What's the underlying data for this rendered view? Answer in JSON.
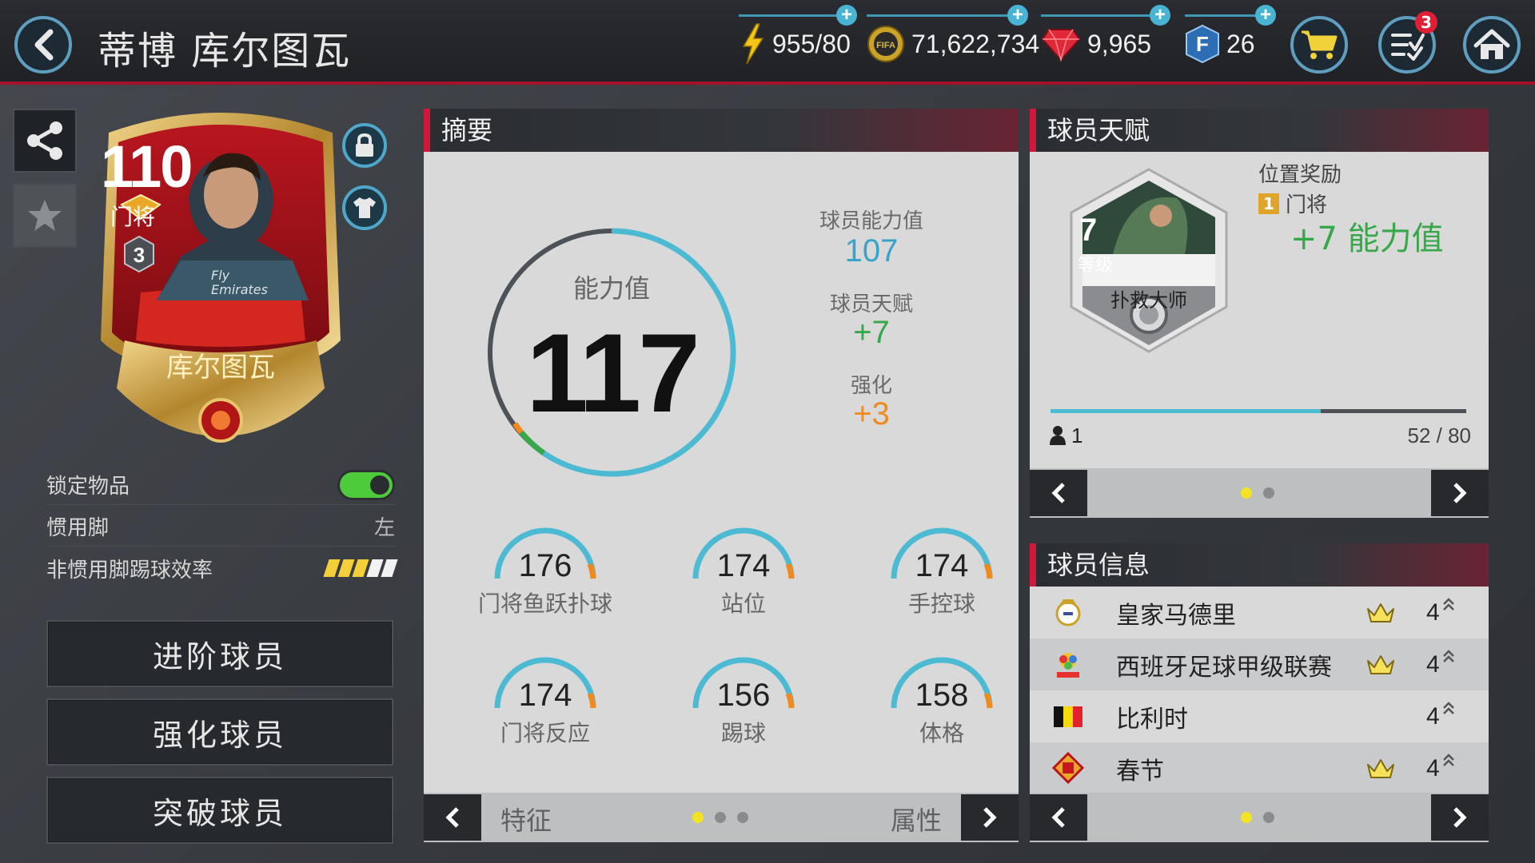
{
  "header": {
    "title": "蒂博 库尔图瓦",
    "energy": "955/80",
    "coins": "71,622,734",
    "gems": "9,965",
    "fifa_points": "26",
    "tasks_badge": "3",
    "coin_icon_text": "FIFA MOBILE",
    "fp_icon_text": "F"
  },
  "card": {
    "rating": "110",
    "position": "门将",
    "rank": "3",
    "name": "库尔图瓦",
    "jersey_text": "Fly Emirates"
  },
  "properties": {
    "lock_label": "锁定物品",
    "lock_on": true,
    "foot_label": "惯用脚",
    "foot_value": "左",
    "weak_foot_label": "非惯用脚踢球效率",
    "weak_foot_stars": 3,
    "weak_foot_max": 5
  },
  "actions": {
    "advance": "进阶球员",
    "enhance": "强化球员",
    "breakthrough": "突破球员"
  },
  "summary": {
    "header": "摘要",
    "ovr_label": "能力值",
    "ovr_value": "117",
    "player_ovr_label": "球员能力值",
    "player_ovr_value": "107",
    "talent_label": "球员天赋",
    "talent_value": "+7",
    "enhance_label": "强化",
    "enhance_value": "+3",
    "stats": [
      {
        "label": "门将鱼跃扑球",
        "value": "176"
      },
      {
        "label": "站位",
        "value": "174"
      },
      {
        "label": "手控球",
        "value": "174"
      },
      {
        "label": "门将反应",
        "value": "174"
      },
      {
        "label": "踢球",
        "value": "156"
      },
      {
        "label": "体格",
        "value": "158"
      }
    ],
    "foot_left": "特征",
    "foot_right": "属性"
  },
  "talent": {
    "header": "球员天赋",
    "level": "7",
    "level_label": "等级",
    "skill_name": "扑救大师",
    "bonus_title": "位置奖励",
    "bonus_rank": "1",
    "bonus_position": "门将",
    "bonus_value": "+7 能力值",
    "user_count": "1",
    "progress_text": "52 / 80",
    "progress_value": 52,
    "progress_max": 80
  },
  "info": {
    "header": "球员信息",
    "rows": [
      {
        "name": "皇家马德里",
        "level": "4",
        "crown": true,
        "icon": "real-madrid-crest-icon"
      },
      {
        "name": "西班牙足球甲级联赛",
        "level": "4",
        "crown": true,
        "icon": "laliga-logo-icon"
      },
      {
        "name": "比利时",
        "level": "4",
        "crown": false,
        "icon": "belgium-flag-icon"
      },
      {
        "name": "春节",
        "level": "4",
        "crown": true,
        "icon": "lunar-new-year-icon"
      }
    ]
  },
  "colors": {
    "accent_red": "#d1173a",
    "accent_blue": "#4cbad2",
    "talent_green": "#37a84a",
    "enhance_orange": "#f08a1c",
    "dot_active": "#f3e323"
  }
}
